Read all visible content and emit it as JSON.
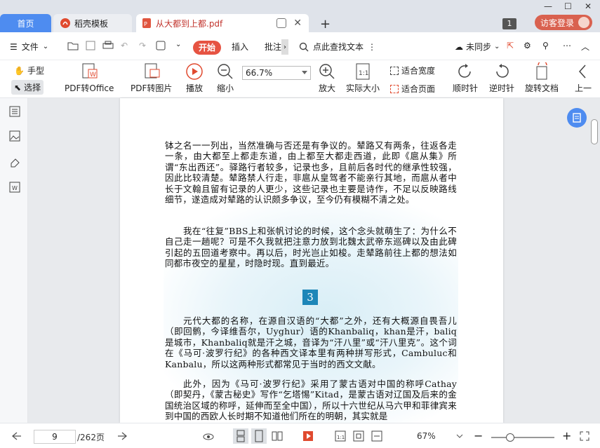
{
  "tabs": {
    "home": "首页",
    "template": "稻壳模板",
    "document": "从大都到上都.pdf"
  },
  "window_count": "1",
  "login": "访客登录",
  "menu": {
    "file": "文件",
    "start": "开始",
    "insert": "插入",
    "annotate": "批注",
    "search": "点此查找文本",
    "sync": "未同步"
  },
  "toolbar": {
    "hand": "手型",
    "select": "选择",
    "pdf_to_office": "PDF转Office",
    "pdf_to_image": "PDF转图片",
    "play": "播放",
    "zoom_out": "缩小",
    "zoom_value": "66.7%",
    "zoom_in": "放大",
    "actual_size": "实际大小",
    "fit_width": "适合宽度",
    "fit_page": "适合页面",
    "rotate_cw": "顺时针",
    "rotate_ccw": "逆时针",
    "rotate_doc": "旋转文档",
    "prev_page": "上一"
  },
  "document": {
    "para1": "钵之名一一列出，当然准确与否还是有争议的。辇路又有两条，往返各走一条，由大都至上都走东道，由上都至大都走西道，此即《扈从集》所谓“东出西还”。驿路行者较多，记录也多，且前后各时代的继承性较强，因此比较清楚。辇路禁人行走，非扈从皇驾者不能亲行其地，而扈从者中长于文翰且留有记录的人更少，这些记录也主要是诗作，不足以反映路线细节，遂造成对辇路的认识颇多争议，至今仍有模糊不清之处。",
    "para2": "我在“往复”BBS上和张帆讨论的时候，这个念头就萌生了：为什么不自己走一趟呢？可是不久我就把注意力放到北魏太武帝东巡碑以及由此碑引起的五回道考察中。再以后，时光岂止如梭。走辇路前往上都的想法如同都市夜空的星星，时隐时现。直到最近。",
    "chapter": "3",
    "para3": "元代大都的名称，在源自汉语的“大都”之外，还有大概源自畏吾儿（即回鹘，今译维吾尔，Uyghur）语的Khanbaliq，khan是汗，baliq是城市，Khanbaliq就是汗之城，音译为“汗八里”或“汗八里克”。这个词在《马可·波罗行纪》的各种西文译本里有两种拼写形式，Cambuluc和Kanbalu，所以这两种形式都常见于当时的西文文献。",
    "para4": "此外，因为《马可·波罗行纪》采用了蒙古语对中国的称呼Cathay（即契丹，《蒙古秘史》写作“乞塔惕”Kitad，是蒙古语对辽国及后来的金国统治区域的称呼，延伸而至全中国），所以十六世纪从马六甲和菲律宾来到中国的西欧人长时期不知道他们所在的明朝，其实就是"
  },
  "status": {
    "current_page": "9",
    "total_pages": "/262页",
    "zoom": "67%",
    "zoom_level_fraction": 0.3
  },
  "colors": {
    "accent": "#4e8cf0",
    "start_button": "#e65342",
    "login": "#d9614f",
    "chapter_badge": "#1d86b8"
  }
}
